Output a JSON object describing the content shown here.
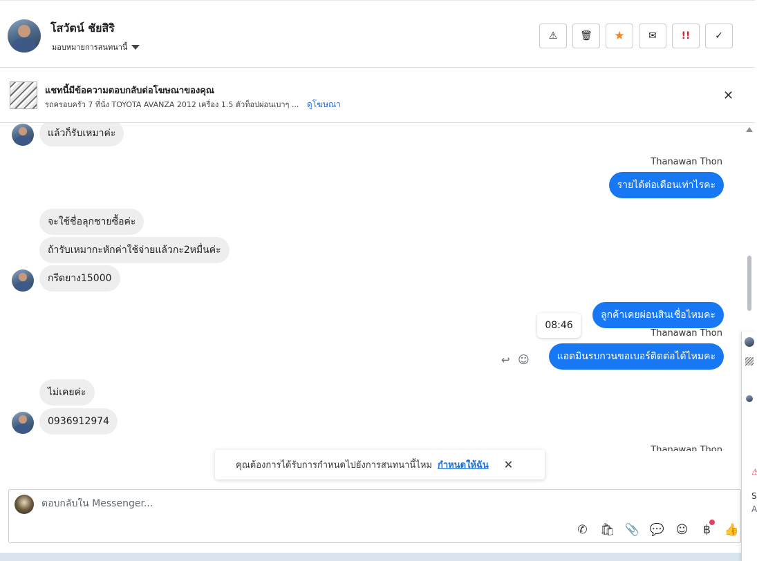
{
  "header": {
    "name": "โสวัตน์ ชัยสิริ",
    "assign_label": "มอบหมายการสนทนานี้",
    "actions": [
      {
        "name": "spam-button",
        "glyph": "⚠"
      },
      {
        "name": "delete-button",
        "glyph": "🗑"
      },
      {
        "name": "star-button",
        "glyph": "★"
      },
      {
        "name": "mark-unread-button",
        "glyph": "✉"
      },
      {
        "name": "follow-up-button",
        "glyph": "!!"
      },
      {
        "name": "done-button",
        "glyph": "✓"
      }
    ]
  },
  "ad_banner": {
    "title": "แชทนี้มีข้อความตอบกลับต่อโฆษณาของคุณ",
    "description": "รถครอบครัว 7 ที่นั่ง TOYOTA AVANZA 2012 เครื่อง 1.5 ตัวท็อปผ่อนเบาๆ ...",
    "link_label": "ดูโฆษณา",
    "close_glyph": "✕"
  },
  "messages": [
    {
      "dir": "in",
      "text": "แล้วก็รับเหมาค่ะ"
    },
    {
      "dir": "out",
      "sender": "Thanawan Thon",
      "text": "รายได้ต่อเดือนเท่าไรคะ"
    },
    {
      "dir": "in",
      "text": "จะใช้ชื่อลุกชายซื้อค่ะ"
    },
    {
      "dir": "in",
      "text": "ถ้ารับเหมากะหักค่าใช้จ่ายแล้วกะ2หมื่นค่ะ"
    },
    {
      "dir": "in",
      "text": "กรีดยาง15000"
    },
    {
      "dir": "out",
      "text": "ลูกค้าเคยผ่อนสินเชื่อไหมคะ"
    },
    {
      "dir": "out",
      "sender": "Thanawan Thon",
      "text": "แอดมินรบกวนขอเบอร์ติดต่อได้ไหมคะ"
    },
    {
      "dir": "in",
      "text": "ไม่เคยค่ะ"
    },
    {
      "dir": "in",
      "text": "0936912974"
    },
    {
      "dir": "out",
      "sender": "Thanawan Thon",
      "text": ""
    }
  ],
  "tooltip_time": "08:46",
  "toast": {
    "text": "คุณต้องการได้รับการกำหนดไปยังการสนทนานี้ไหม",
    "link": "กำหนดให้ฉัน",
    "close_glyph": "✕"
  },
  "composer": {
    "placeholder": "ตอบกลับใน Messenger...",
    "tools": [
      {
        "name": "call-icon",
        "glyph": "✆"
      },
      {
        "name": "shopping-bag-icon",
        "glyph": "🛍"
      },
      {
        "name": "attachment-icon",
        "glyph": "📎"
      },
      {
        "name": "saved-replies-icon",
        "glyph": "💬"
      },
      {
        "name": "emoji-icon",
        "glyph": "☺"
      },
      {
        "name": "payment-icon",
        "glyph": "฿"
      },
      {
        "name": "like-icon",
        "glyph": "👍"
      }
    ]
  },
  "side_panel": {
    "text_s": "S",
    "text_a": "A"
  },
  "colors": {
    "outgoing_bubble": "#1877f2",
    "incoming_bubble": "#eeeeee",
    "link": "#1a6ed8",
    "star": "#f5821f",
    "alert": "#e4405f"
  }
}
